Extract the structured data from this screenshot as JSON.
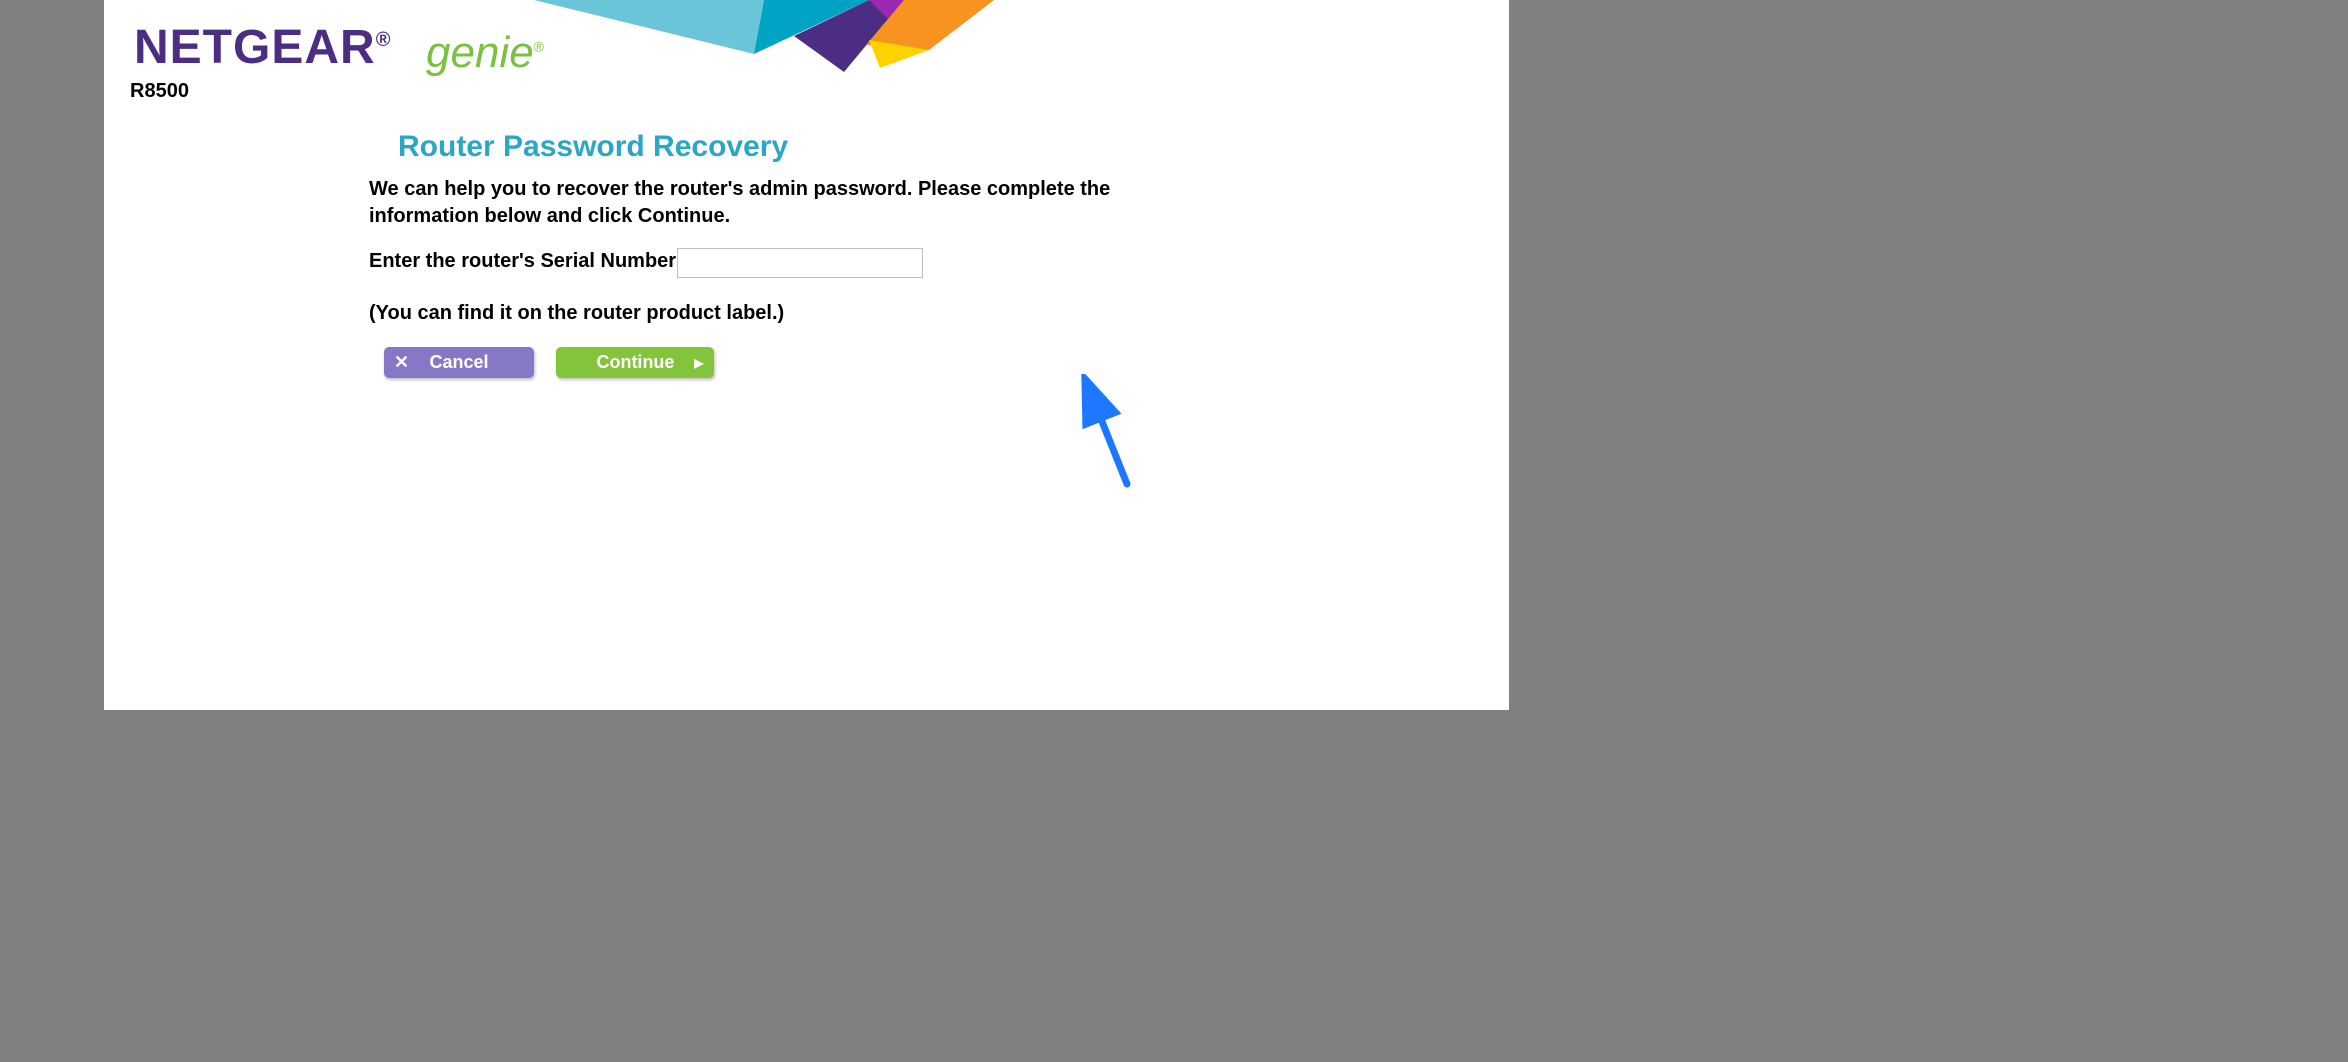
{
  "brand": {
    "name": "NETGEAR",
    "subbrand": "genie",
    "model": "R8500"
  },
  "page": {
    "title": "Router Password Recovery",
    "description": "We can help you to recover the router's admin password. Please complete the information below and click Continue.",
    "serial_label": "Enter the router's Serial Number",
    "serial_value": "",
    "hint": "(You can find it on the router product label.)"
  },
  "buttons": {
    "cancel": "Cancel",
    "continue": "Continue"
  }
}
